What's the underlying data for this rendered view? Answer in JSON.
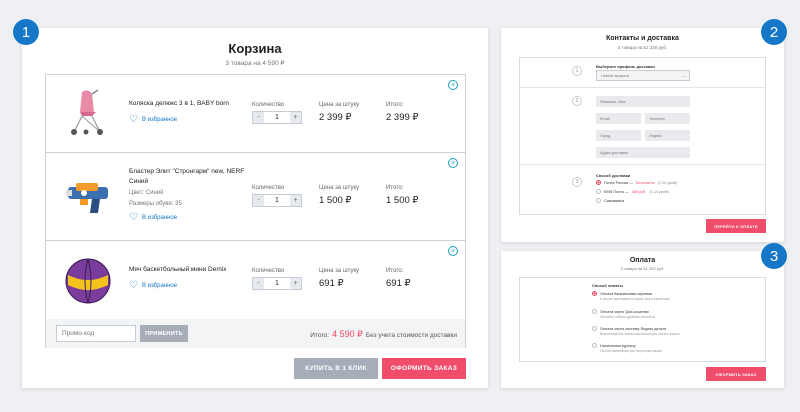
{
  "badges": [
    "1",
    "2",
    "3"
  ],
  "cart": {
    "title": "Корзина",
    "subtitle": "3 товара на 4 590 ₽",
    "labels": {
      "quantity": "Количество",
      "unit_price": "Цена за штуку",
      "total": "Итого:",
      "favorite": "В избранное"
    },
    "items": [
      {
        "name": "Коляска делюкс 3 в 1, BABY born",
        "meta": [],
        "qty": "1",
        "price": "2 399 ₽",
        "total": "2 399 ₽",
        "icon": "stroller-icon"
      },
      {
        "name": "Бластер Элит \"Стронгарм\" new, NERF Синий",
        "meta": [
          "Цвет: Синий",
          "Размеры обуви: 35"
        ],
        "qty": "1",
        "price": "1 500 ₽",
        "total": "1 500 ₽",
        "icon": "blaster-icon"
      },
      {
        "name": "Мяч баскетбольный мини Demix",
        "meta": [],
        "qty": "1",
        "price": "691 ₽",
        "total": "691 ₽",
        "icon": "ball-icon"
      }
    ],
    "promo_placeholder": "Промо-код",
    "apply_label": "ПРИМЕНИТЬ",
    "total_prefix": "Итого:",
    "total_sum": "4 590 ₽",
    "total_suffix": "Без учета стоимости доставки",
    "one_click_label": "КУПИТЬ В 1 КЛИК",
    "checkout_label": "ОФОРМИТЬ ЗАКАЗ"
  },
  "delivery": {
    "title": "Контакты и доставка",
    "subtitle": "3 товара на 51 220 руб.",
    "steps": [
      "1",
      "2",
      "3"
    ],
    "profile_label": "Выберите профиль доставки",
    "profile_value": "Новый профиль",
    "fields": {
      "name": "Фамилия, Имя",
      "email": "Email",
      "phone": "Телефон",
      "city": "Город",
      "index": "Индекс",
      "address": "Адрес доставки"
    },
    "shipping_label": "Способ доставки",
    "shipping_options": [
      {
        "name": "Почта России —",
        "price": "Бесплатно",
        "term": "(7-20 дней)",
        "selected": true
      },
      {
        "name": "EMS Почта —",
        "price": "386 руб.",
        "term": "(3-14 дней)",
        "selected": false
      },
      {
        "name": "Самовывоз",
        "price": "",
        "term": "",
        "selected": false
      }
    ],
    "next_label": "ПЕРЕЙТИ К ОПЛАТЕ"
  },
  "payment": {
    "title": "Оплата",
    "subtitle": "3 товара на 51 220 руб.",
    "method_label": "Способ оплаты",
    "options": [
      {
        "name": "Оплата банковскими картами",
        "desc": "К оплате принимаются карты Visa и Mastercard",
        "selected": true
      },
      {
        "name": "Оплата через Qiwi-кошелек",
        "desc": "Оплатите любым удобным способом",
        "selected": false
      },
      {
        "name": "Оплата через систему Яндекс.деньги",
        "desc": "Воспользуйтесь своим кошельком для оплаты заказа",
        "selected": false
      },
      {
        "name": "Наличными курьеру",
        "desc": "Оплата наличными при получении заказа",
        "selected": false
      }
    ],
    "checkout_label": "ОФОРМИТЬ ЗАКАЗ"
  },
  "colors": {
    "accent": "#f04d6b",
    "blue": "#1677c9",
    "price_red": "#ec4964",
    "disabled": "#a6adb8"
  }
}
